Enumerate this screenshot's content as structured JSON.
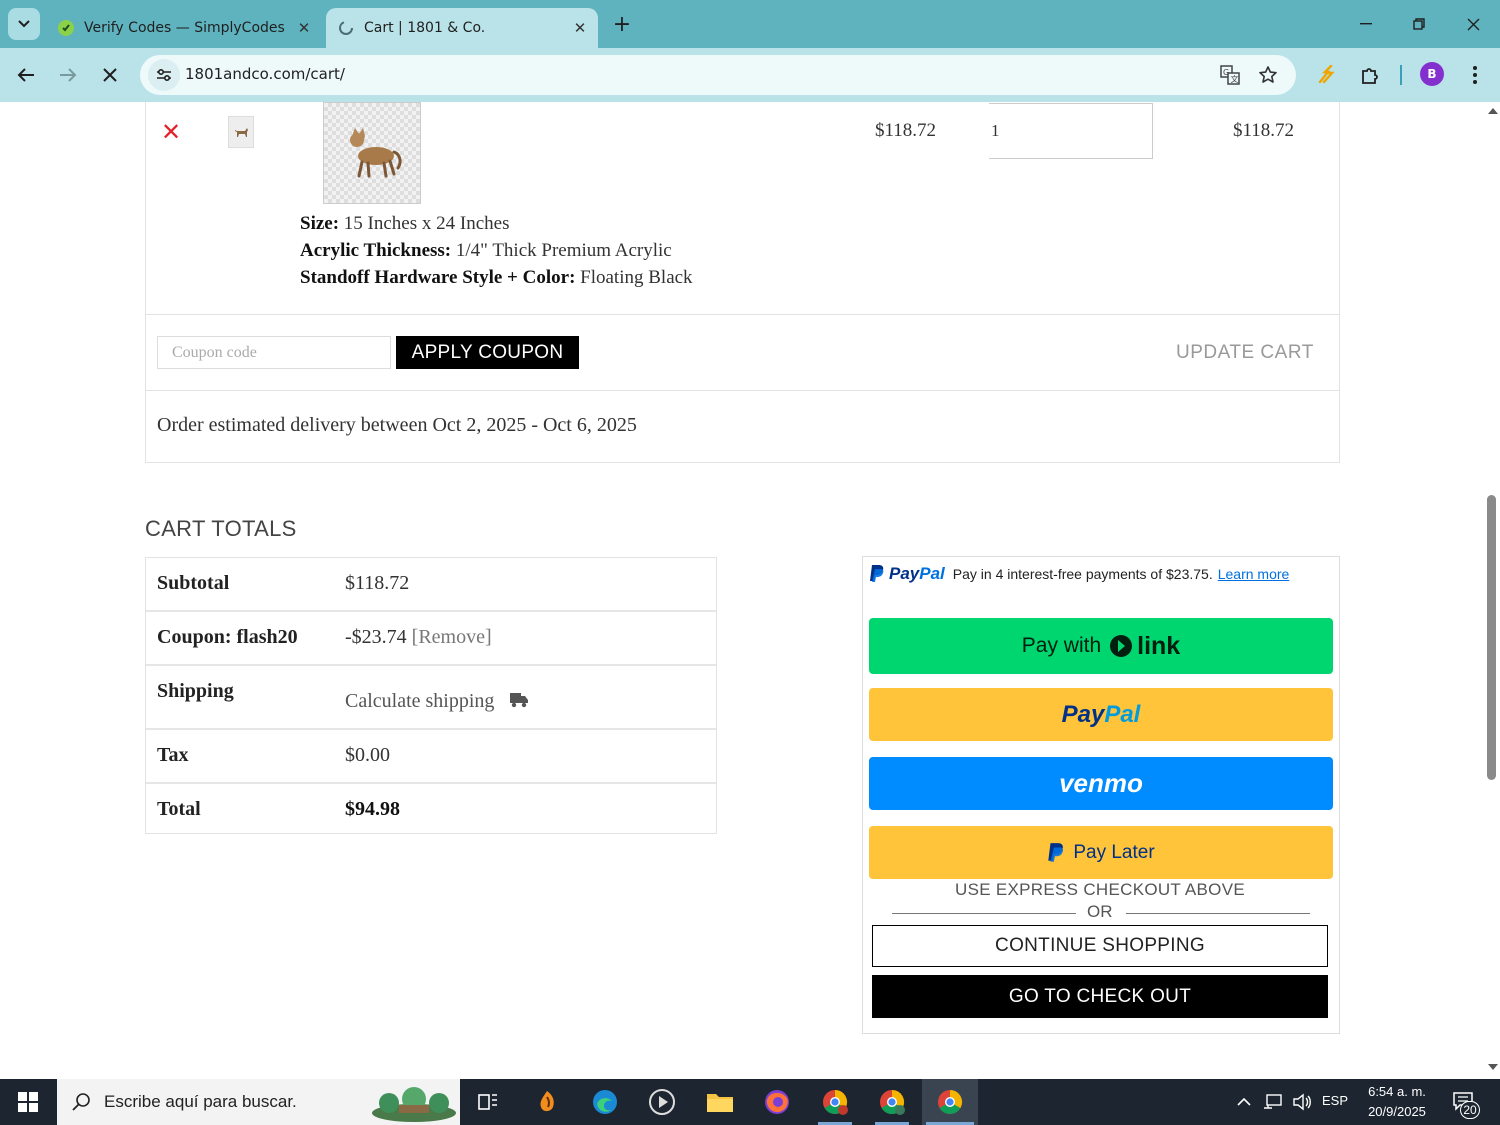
{
  "browser": {
    "tabs": [
      {
        "title": "Verify Codes — SimplyCodes",
        "favicon": "simplycodes-icon",
        "active": false
      },
      {
        "title": "Cart | 1801 & Co.",
        "favicon": "loading-icon",
        "active": true
      }
    ],
    "url": "1801andco.com/cart/",
    "profile_initial": "B",
    "colors": {
      "tabstrip": "#5fb3bf",
      "toolbar": "#b9e3e8",
      "profile": "#8430ce"
    }
  },
  "cart_item": {
    "price": "$118.72",
    "quantity": "1",
    "subtotal": "$118.72",
    "meta": [
      {
        "label": "Size:",
        "value": "15 Inches x 24 Inches"
      },
      {
        "label": "Acrylic Thickness:",
        "value": "1/4\" Thick Premium Acrylic"
      },
      {
        "label": "Standoff Hardware Style + Color:",
        "value": "Floating Black"
      }
    ]
  },
  "actions": {
    "coupon_placeholder": "Coupon code",
    "apply_coupon": "APPLY COUPON",
    "update_cart": "UPDATE CART"
  },
  "delivery_text": "Order estimated delivery between Oct 2, 2025 - Oct 6, 2025",
  "cart_totals": {
    "heading": "CART TOTALS",
    "rows": [
      {
        "label": "Subtotal",
        "value": "$118.72"
      },
      {
        "label": "Coupon: flash20",
        "value": "-$23.74",
        "extra": "[Remove]"
      },
      {
        "label": "Shipping",
        "value": "Calculate shipping"
      },
      {
        "label": "Tax",
        "value": "$0.00"
      },
      {
        "label": "Total",
        "value": "$94.98"
      }
    ]
  },
  "checkout": {
    "paypal_brand_pay": "Pay",
    "paypal_brand_pal": "Pal",
    "paypal_message": "Pay in 4 interest-free payments of $23.75.",
    "learn_more": "Learn more",
    "link_button_prefix": "Pay with",
    "link_button_brand": "link",
    "paypal_button_pay": "Pay",
    "paypal_button_pal": "Pal",
    "venmo_button": "venmo",
    "pay_later_button": "Pay Later",
    "express_note": "USE EXPRESS CHECKOUT ABOVE",
    "or": "OR",
    "continue_shopping": "CONTINUE SHOPPING",
    "go_to_checkout": "GO TO CHECK OUT",
    "colors": {
      "link": "#00d66f",
      "paypal": "#ffc439",
      "venmo": "#008cff"
    }
  },
  "taskbar": {
    "search_placeholder": "Escribe aquí para buscar.",
    "language": "ESP",
    "time": "6:54 a. m.",
    "date": "20/9/2025",
    "notifications": "20"
  }
}
